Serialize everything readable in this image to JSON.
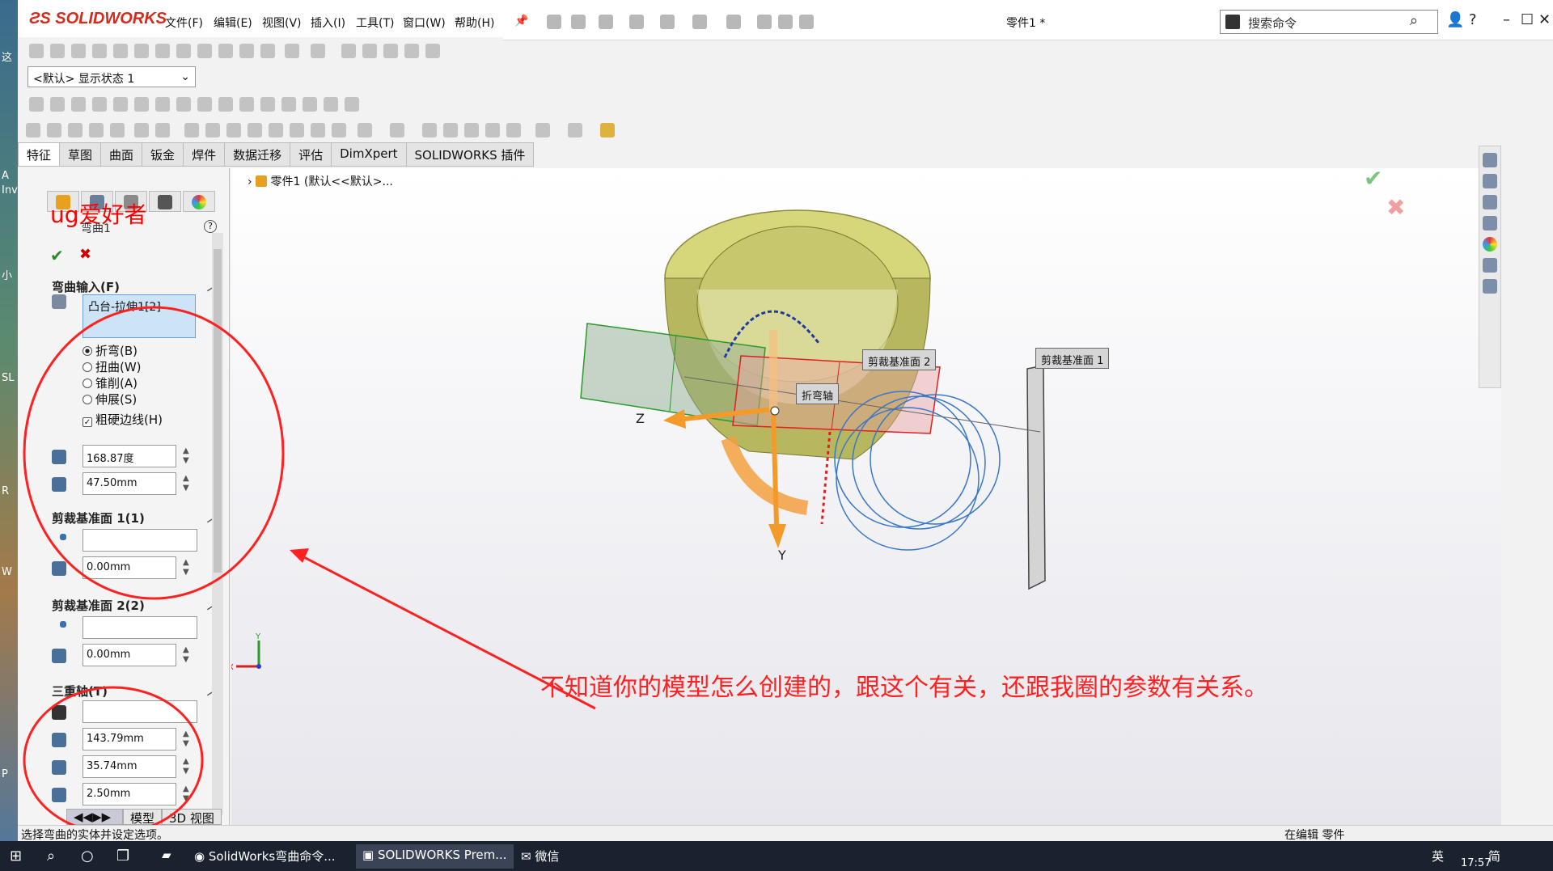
{
  "app": {
    "brand": "SOLIDWORKS",
    "doc_title": "零件1 *"
  },
  "menu": [
    "文件(F)",
    "编辑(E)",
    "视图(V)",
    "插入(I)",
    "工具(T)",
    "窗口(W)",
    "帮助(H)"
  ],
  "search": {
    "placeholder": "搜索命令"
  },
  "window_buttons": [
    "?",
    "–",
    "☐",
    "✕"
  ],
  "display_state": "<默认> 显示状态 1",
  "tabs": [
    "特征",
    "草图",
    "曲面",
    "钣金",
    "焊件",
    "数据迁移",
    "评估",
    "DimXpert",
    "SOLIDWORKS 插件"
  ],
  "tree_item": "零件1 (默认<<默认>...",
  "panel": {
    "watermark": "ug爱好者",
    "feature_name": "弯曲1",
    "bend_input": {
      "title": "弯曲输入(F)",
      "selection": "凸台-拉伸1[2]",
      "options": [
        "折弯(B)",
        "扭曲(W)",
        "锥削(A)",
        "伸展(S)"
      ],
      "selected_option": "折弯(B)",
      "rigid_edges": "粗硬边线(H)",
      "angle": "168.87度",
      "radius": "47.50mm"
    },
    "trim_plane1": {
      "title": "剪裁基准面 1(1)",
      "distance": "0.00mm"
    },
    "trim_plane2": {
      "title": "剪裁基准面 2(2)",
      "distance": "0.00mm"
    },
    "triad": {
      "title": "三重轴(T)",
      "x": "143.79mm",
      "y": "35.74mm",
      "z": "2.50mm"
    }
  },
  "bottom_tabs": [
    "模型",
    "3D 视图"
  ],
  "status": {
    "left": "选择弯曲的实体并设定选项。",
    "right": "在编辑 零件"
  },
  "viewport_labels": {
    "trim1": "剪裁基准面 1",
    "trim2": "剪裁基准面 2",
    "bend_axis": "折弯轴",
    "axis_z": "Z",
    "axis_y": "Y",
    "triad_x": "X",
    "triad_y": "Y"
  },
  "annotation": "不知道你的模型怎么创建的，跟这个有关，还跟我圈的参数有关系。",
  "taskbar": {
    "items": [
      "SolidWorks弯曲命令...",
      "SOLIDWORKS Prem...",
      "微信"
    ],
    "ime": "英",
    "ime2": "简",
    "clock": "17:57"
  },
  "colors": {
    "brand_red": "#d52b1e",
    "annotation_red": "#ff2020",
    "model_yellow": "#d9d97a"
  }
}
